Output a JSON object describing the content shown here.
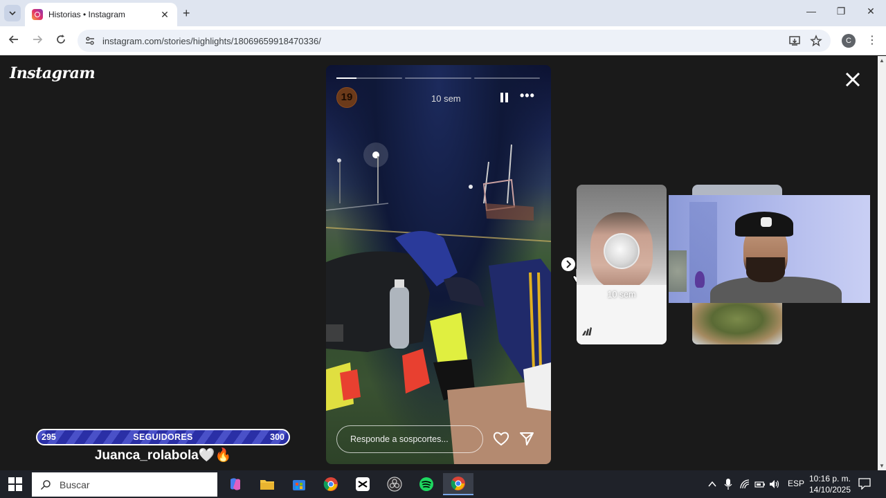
{
  "browser": {
    "tab_title": "Historias • Instagram",
    "tab_close": "✕",
    "new_tab": "+",
    "url": "instagram.com/stories/highlights/18069659918470336/",
    "profile_initial": "C",
    "window_controls": {
      "minimize": "—",
      "restore": "❐",
      "close": "✕"
    }
  },
  "page": {
    "logo": "Instagram",
    "story": {
      "avatar_text": "19",
      "time": "10 sem",
      "reply_placeholder": "Responde a sospcortes...",
      "progress_segments": 3,
      "active_segment": 0
    },
    "preview": {
      "time": "10 sem"
    }
  },
  "overlay": {
    "followers": {
      "current": "295",
      "label": "SEGUIDORES",
      "goal": "300"
    },
    "username": "Juanca_rolabola🤍🔥"
  },
  "taskbar": {
    "search_placeholder": "Buscar",
    "language": "ESP",
    "time": "10:16 p. m.",
    "date": "14/10/2025"
  },
  "colors": {
    "story_bg": "#1a1a1a",
    "follow_bar": "#2a2fa6",
    "taskbar": "#1f2229"
  }
}
